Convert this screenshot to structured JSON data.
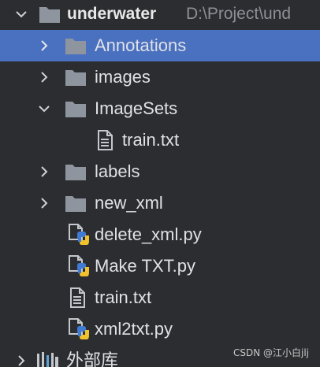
{
  "root": {
    "name": "underwater",
    "path": "D:\\Project\\und"
  },
  "items": [
    {
      "label": "Annotations"
    },
    {
      "label": "images"
    },
    {
      "label": "ImageSets"
    },
    {
      "label": "train.txt"
    },
    {
      "label": "labels"
    },
    {
      "label": "new_xml"
    },
    {
      "label": "delete_xml.py"
    },
    {
      "label": "Make TXT.py"
    },
    {
      "label": "train.txt"
    },
    {
      "label": "xml2txt.py"
    }
  ],
  "external_libraries": {
    "label": "外部库"
  },
  "watermark": "CSDN @江小白jlj",
  "colors": {
    "background": "#2b2d30",
    "selection": "#4a70c0",
    "folder": "#8f959e",
    "text": "#dfe1e5",
    "muted": "#8c8f94",
    "python_blue": "#3f7bd3",
    "python_yellow": "#f2c12e"
  },
  "icons": {
    "expand": "chevron-right-icon",
    "collapse": "chevron-down-icon",
    "folder": "folder-icon",
    "text_file": "text-file-icon",
    "python_file": "python-file-icon",
    "library": "library-icon"
  }
}
